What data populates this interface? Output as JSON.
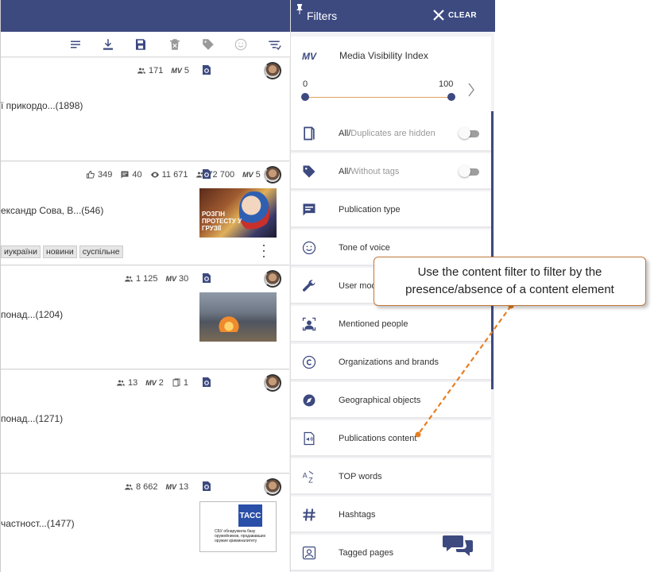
{
  "colors": {
    "brand": "#3d4a80",
    "accent": "#e67e22",
    "slider": "#d9a45f"
  },
  "toolbar": {
    "icons": [
      "list-icon",
      "download-icon",
      "save-icon",
      "delete-icon",
      "tag-icon",
      "smiley-icon",
      "sort-filter-icon"
    ]
  },
  "cards": [
    {
      "audience": "171",
      "mv": "5",
      "title": "ї прикордо...(1898)"
    },
    {
      "likes": "349",
      "comments": "40",
      "views": "11 671",
      "audience": "72 700",
      "mv": "5",
      "title": "ександр Сова, В...(546)",
      "thumb_text": "РОЗГІН ПРОТЕСТУ У ГРУЗІЇ",
      "tags": [
        "иукраїни",
        "новини",
        "суспільне"
      ]
    },
    {
      "audience": "1 125",
      "mv": "30",
      "title": "понад...(1204)"
    },
    {
      "audience": "13",
      "mv": "2",
      "duplicates": "1",
      "title": "понад...(1271)"
    },
    {
      "audience": "8 662",
      "mv": "13",
      "title": "частност...(1477)",
      "thumb_logo": "ТАСС",
      "thumb_caption": "СБУ обнаружила базу оружейников, продававших оружие криминалитету"
    }
  ],
  "mv_label": "MV",
  "filters": {
    "title": "Filters",
    "clear_label": "CLEAR",
    "mvi": {
      "logo": "MV",
      "label": "Media Visibility Index",
      "min": "0",
      "max": "100"
    },
    "rows": [
      {
        "icon": "duplicates-icon",
        "label_main": "All/",
        "label_muted": "Duplicates are hidden",
        "toggle": false
      },
      {
        "icon": "tag-icon",
        "label_main": "All/",
        "label_muted": "Without tags",
        "toggle": false
      },
      {
        "icon": "publication-type-icon",
        "label": "Publication type"
      },
      {
        "icon": "smiley-icon",
        "label": "Tone of voice"
      },
      {
        "icon": "wrench-icon",
        "label": "User mod"
      },
      {
        "icon": "person-icon",
        "label": "Mentioned people"
      },
      {
        "icon": "copyright-icon",
        "label": "Organizations and brands"
      },
      {
        "icon": "compass-icon",
        "label": "Geographical objects"
      },
      {
        "icon": "content-icon",
        "label": "Publications content"
      },
      {
        "icon": "az-icon",
        "label": "TOP words"
      },
      {
        "icon": "hashtag-icon",
        "label": "Hashtags"
      },
      {
        "icon": "tagged-pages-icon",
        "label": "Tagged pages"
      }
    ]
  },
  "callout": {
    "text": "Use the content filter to filter by the presence/absence of a content element"
  }
}
